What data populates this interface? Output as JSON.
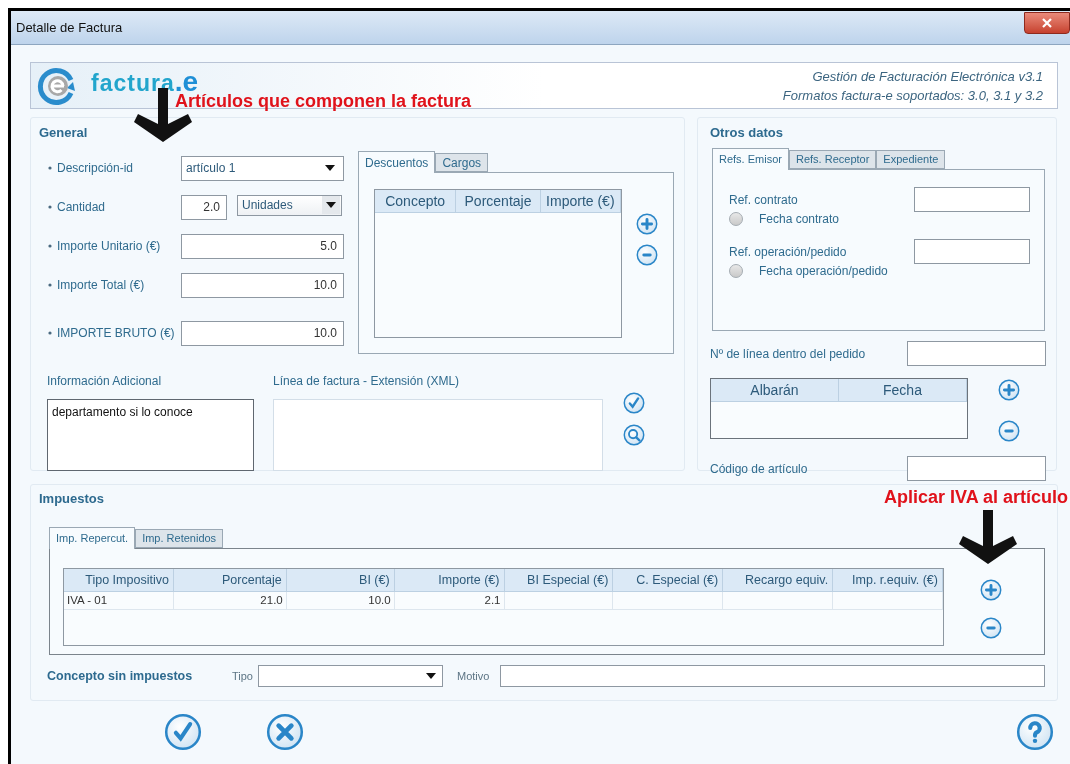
{
  "window": {
    "title": "Detalle de Factura"
  },
  "header": {
    "logo_text": "factura",
    "logo_suffix": ".e",
    "tagline": [
      "Gestión de Facturación Electrónica v3.1",
      "Formatos factura-e soportados: 3.0, 3.1 y 3.2"
    ]
  },
  "annotations": [
    {
      "text": "Artículos que componen la factura"
    },
    {
      "text": "Aplicar IVA al artículo"
    }
  ],
  "general": {
    "title": "General",
    "fields": [
      {
        "kind": "select",
        "label": "Descripción-id",
        "required": true,
        "value": "artículo 1"
      },
      {
        "kind": "quantity",
        "label": "Cantidad",
        "required": true,
        "value": "2.0",
        "unit": "Unidades"
      },
      {
        "kind": "amount",
        "label": "Importe Unitario (€)",
        "required": true,
        "value": "5.0"
      },
      {
        "kind": "amount",
        "label": "Importe Total (€)",
        "required": true,
        "value": "10.0"
      },
      {
        "kind": "total",
        "label": "IMPORTE BRUTO (€)",
        "required": true,
        "value": "10.0"
      }
    ],
    "adjustments": {
      "tabs": [
        {
          "label": "Descuentos",
          "selected": true
        },
        {
          "label": "Cargos",
          "selected": false
        }
      ],
      "columns": [
        "Concepto",
        "Porcentaje",
        "Importe (€)"
      ]
    },
    "additional_info": {
      "label": "Información Adicional",
      "value": "departamento si lo conoce"
    },
    "extension": {
      "label": "Línea de factura - Extensión (XML)"
    }
  },
  "other_data": {
    "title": "Otros datos",
    "tabs": [
      {
        "label": "Refs. Emisor",
        "selected": true
      },
      {
        "label": "Refs. Receptor",
        "selected": false
      },
      {
        "label": "Expediente",
        "selected": false
      }
    ],
    "refs": [
      {
        "label": "Ref. contrato",
        "radio": {
          "label": "Fecha contrato",
          "selected": false
        }
      },
      {
        "label": "Ref. operación/pedido",
        "radio": {
          "label": "Fecha operación/pedido",
          "selected": false
        }
      }
    ],
    "line_number_label": "Nº de línea dentro del pedido",
    "delivery_columns": [
      "Albarán",
      "Fecha"
    ],
    "article_code_label": "Código de artículo"
  },
  "taxes": {
    "title": "Impuestos",
    "tabs": [
      {
        "label": "Imp. Repercut.",
        "selected": true
      },
      {
        "label": "Imp. Retenidos",
        "selected": false
      }
    ],
    "columns": [
      "Tipo Impositivo",
      "Porcentaje",
      "BI (€)",
      "Importe (€)",
      "BI Especial (€)",
      "C. Especial (€)",
      "Recargo equiv.",
      "Imp. r.equiv. (€)"
    ],
    "rows": [
      {
        "cells": [
          "IVA - 01",
          "21.0",
          "10.0",
          "2.1"
        ]
      }
    ],
    "exempt": {
      "label": "Concepto sin impuestos",
      "type_label": "Tipo",
      "reason_label": "Motivo"
    }
  }
}
